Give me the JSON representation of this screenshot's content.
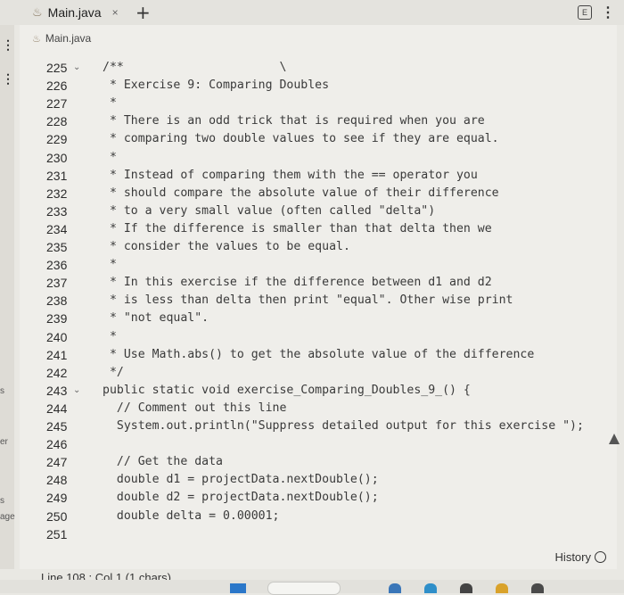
{
  "tab": {
    "title": "Main.java",
    "close_glyph": "×",
    "new_tab_glyph": "+"
  },
  "editor": {
    "file_label": "Main.java",
    "lines": [
      {
        "num": "225",
        "fold": true,
        "text": "/**                      \\"
      },
      {
        "num": "226",
        "fold": false,
        "text": " * Exercise 9: Comparing Doubles"
      },
      {
        "num": "227",
        "fold": false,
        "text": " *"
      },
      {
        "num": "228",
        "fold": false,
        "text": " * There is an odd trick that is required when you are"
      },
      {
        "num": "229",
        "fold": false,
        "text": " * comparing two double values to see if they are equal."
      },
      {
        "num": "230",
        "fold": false,
        "text": " *"
      },
      {
        "num": "231",
        "fold": false,
        "text": " * Instead of comparing them with the == operator you"
      },
      {
        "num": "232",
        "fold": false,
        "text": " * should compare the absolute value of their difference"
      },
      {
        "num": "233",
        "fold": false,
        "text": " * to a very small value (often called \"delta\")"
      },
      {
        "num": "234",
        "fold": false,
        "text": " * If the difference is smaller than that delta then we"
      },
      {
        "num": "235",
        "fold": false,
        "text": " * consider the values to be equal."
      },
      {
        "num": "236",
        "fold": false,
        "text": " *"
      },
      {
        "num": "237",
        "fold": false,
        "text": " * In this exercise if the difference between d1 and d2"
      },
      {
        "num": "238",
        "fold": false,
        "text": " * is less than delta then print \"equal\". Other wise print"
      },
      {
        "num": "239",
        "fold": false,
        "text": " * \"not equal\"."
      },
      {
        "num": "240",
        "fold": false,
        "text": " *"
      },
      {
        "num": "241",
        "fold": false,
        "text": " * Use Math.abs() to get the absolute value of the difference"
      },
      {
        "num": "242",
        "fold": false,
        "text": " */"
      },
      {
        "num": "243",
        "fold": true,
        "text": "public static void exercise_Comparing_Doubles_9_() {"
      },
      {
        "num": "244",
        "fold": false,
        "text": "  // Comment out this line"
      },
      {
        "num": "245",
        "fold": false,
        "text": "  System.out.println(\"Suppress detailed output for this exercise \");"
      },
      {
        "num": "246",
        "fold": false,
        "text": ""
      },
      {
        "num": "247",
        "fold": false,
        "text": "  // Get the data"
      },
      {
        "num": "248",
        "fold": false,
        "text": "  double d1 = projectData.nextDouble();"
      },
      {
        "num": "249",
        "fold": false,
        "text": "  double d2 = projectData.nextDouble();"
      },
      {
        "num": "250",
        "fold": false,
        "text": "  double delta = 0.00001;"
      },
      {
        "num": "251",
        "fold": false,
        "text": ""
      }
    ],
    "fold_glyph": "⌄"
  },
  "status": {
    "position": "Line 108 : Col 1 (1 chars)",
    "history_label": "History"
  },
  "left_strip": {
    "frag1": "s",
    "frag2": "er",
    "frag3": "s",
    "frag4": "age"
  },
  "icons": {
    "java_icon": "♨",
    "kebab": "⋮"
  }
}
